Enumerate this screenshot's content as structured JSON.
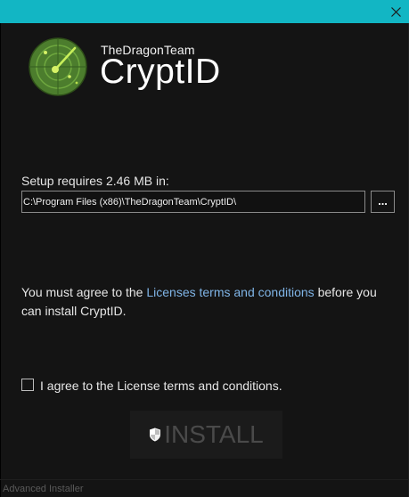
{
  "window": {
    "close_icon": "close-icon",
    "accent_color": "#12b6c4"
  },
  "header": {
    "company": "TheDragonTeam",
    "product": "CryptID",
    "logo_icon": "radar-logo-icon"
  },
  "setup": {
    "requirement_text": "Setup requires 2.46 MB in:",
    "install_path": "C:\\Program Files (x86)\\TheDragonTeam\\CryptID\\",
    "browse_label": "..."
  },
  "license": {
    "message_before": "You must agree to the ",
    "link_text": "Licenses terms and conditions",
    "message_after": " before you can install CryptID.",
    "link_color": "#7fb4e6"
  },
  "agreement": {
    "checkbox_label": "I agree to the License terms and conditions.",
    "checked": false
  },
  "install_button": {
    "label": "INSTALL",
    "enabled": false,
    "icon": "shield-icon"
  },
  "footer": {
    "brand": "Advanced Installer"
  }
}
